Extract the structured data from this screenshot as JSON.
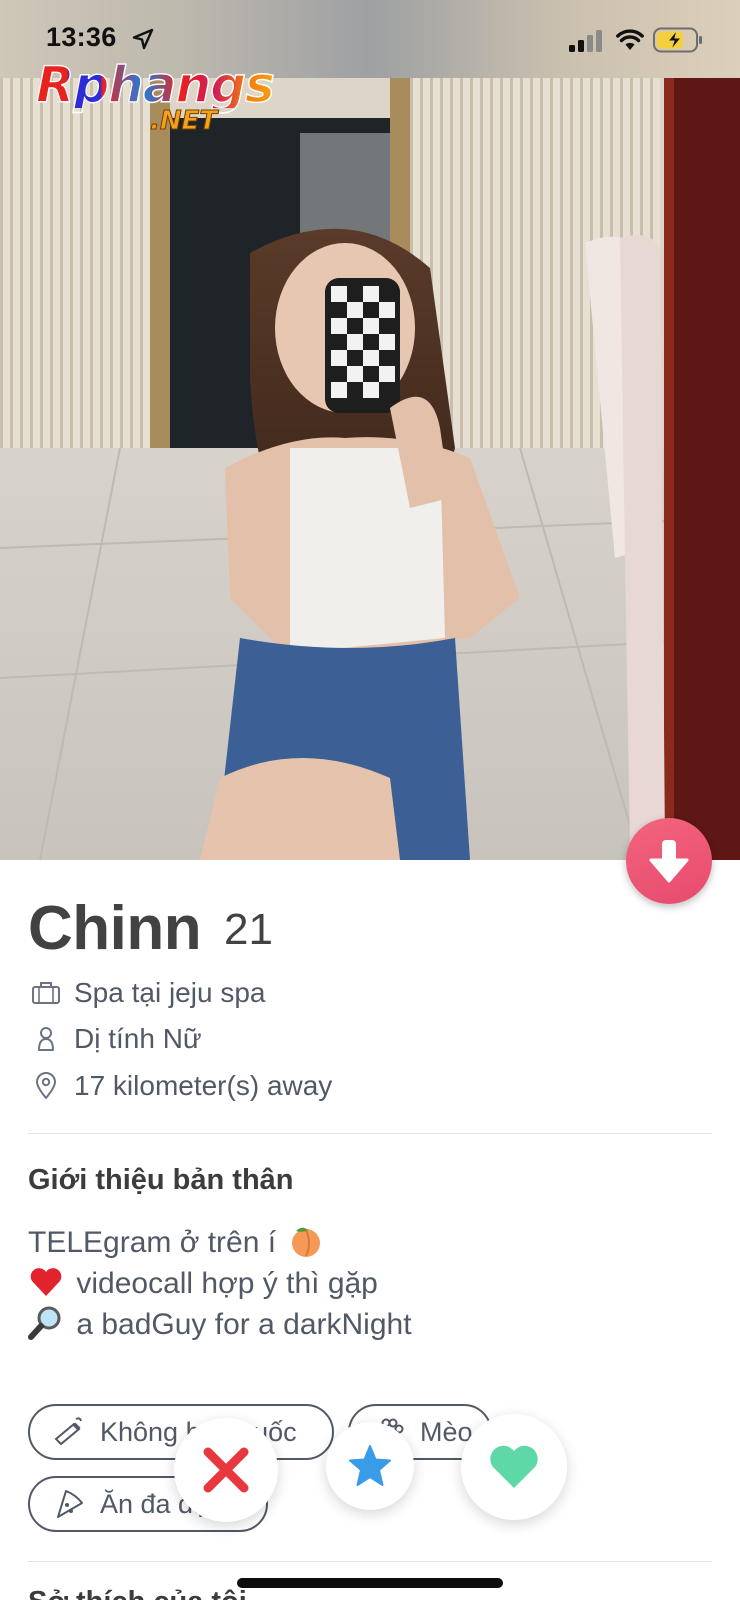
{
  "status_bar": {
    "time": "13:36"
  },
  "watermark": {
    "main": "Rphangs",
    "sub": ".NET"
  },
  "profile": {
    "name": "Chinn",
    "age": "21",
    "job": "Spa tại jeju spa",
    "gender": "Dị tính Nữ",
    "distance": "17 kilometer(s) away"
  },
  "about": {
    "title": "Giới thiệu bản thân",
    "lines": [
      {
        "before": "TELEgram ở trên í",
        "emoji": "peach-emoji",
        "after": ""
      },
      {
        "before": "",
        "emoji": "red-heart-emoji",
        "after": "videocall hợp ý thì gặp"
      },
      {
        "before": "",
        "emoji": "magnifier-emoji",
        "after": "a badGuy for a darkNight"
      }
    ]
  },
  "tags": [
    {
      "label": "Không hút thuốc",
      "icon": "no-smoking-icon"
    },
    {
      "label": "Mèo",
      "icon": "paw-icon"
    },
    {
      "label": "Ăn đa dạng",
      "icon": "pizza-icon"
    }
  ],
  "next_section": {
    "title": "Sở thích của tôi"
  },
  "colors": {
    "accent": "#E84A6F",
    "superlike": "#3A9BE8",
    "like": "#5FD8A8",
    "nope": "#E8373F",
    "text": "#505965"
  }
}
